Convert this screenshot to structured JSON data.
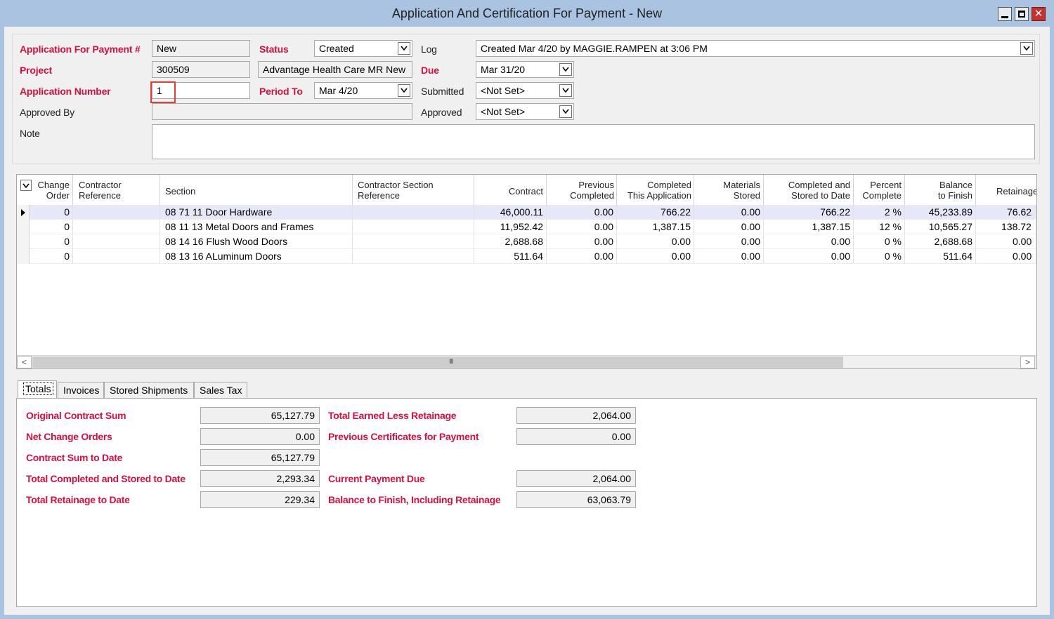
{
  "window": {
    "title": "Application And Certification For Payment - New",
    "close_glyph": "✕"
  },
  "header": {
    "app_payment_label": "Application For Payment #",
    "app_payment_value": "New",
    "project_label": "Project",
    "project_id": "300509",
    "project_name": "Advantage Health Care MR New",
    "app_number_label": "Application Number",
    "app_number_value": "1",
    "approved_by_label": "Approved By",
    "approved_by_value": "",
    "note_label": "Note",
    "note_value": "",
    "status_label": "Status",
    "status_value": "Created",
    "period_to_label": "Period To",
    "period_to_value": "Mar 4/20",
    "log_label": "Log",
    "log_value": "Created Mar 4/20 by MAGGIE.RAMPEN at 3:06 PM",
    "due_label": "Due",
    "due_value": "Mar 31/20",
    "submitted_label": "Submitted",
    "submitted_value": "<Not Set>",
    "approved_label": "Approved",
    "approved_value": "<Not Set>"
  },
  "grid": {
    "columns": [
      "Change\nOrder",
      "Contractor\nReference",
      "Section",
      "Contractor Section\nReference",
      "Contract",
      "Previous\nCompleted",
      "Completed\nThis Application",
      "Materials\nStored",
      "Completed and\nStored to Date",
      "Percent\nComplete",
      "Balance\nto Finish",
      "Retainage"
    ],
    "rows": [
      {
        "change_order": "0",
        "contractor_ref": "",
        "section": "08 71 11 Door Hardware",
        "section_ref": "",
        "contract": "46,000.11",
        "previous": "0.00",
        "this_app": "766.22",
        "materials": "0.00",
        "to_date": "766.22",
        "percent": "2 %",
        "balance": "45,233.89",
        "retainage": "76.62"
      },
      {
        "change_order": "0",
        "contractor_ref": "",
        "section": "08 11 13 Metal Doors and Frames",
        "section_ref": "",
        "contract": "11,952.42",
        "previous": "0.00",
        "this_app": "1,387.15",
        "materials": "0.00",
        "to_date": "1,387.15",
        "percent": "12 %",
        "balance": "10,565.27",
        "retainage": "138.72"
      },
      {
        "change_order": "0",
        "contractor_ref": "",
        "section": "08 14 16 Flush Wood Doors",
        "section_ref": "",
        "contract": "2,688.68",
        "previous": "0.00",
        "this_app": "0.00",
        "materials": "0.00",
        "to_date": "0.00",
        "percent": "0 %",
        "balance": "2,688.68",
        "retainage": "0.00"
      },
      {
        "change_order": "0",
        "contractor_ref": "",
        "section": "08 13 16 ALuminum Doors",
        "section_ref": "",
        "contract": "511.64",
        "previous": "0.00",
        "this_app": "0.00",
        "materials": "0.00",
        "to_date": "0.00",
        "percent": "0 %",
        "balance": "511.64",
        "retainage": "0.00"
      }
    ],
    "scroll_grip": "III",
    "scroll_left": "<",
    "scroll_right": ">"
  },
  "tabs": [
    "Totals",
    "Invoices",
    "Stored Shipments",
    "Sales Tax"
  ],
  "totals": {
    "original_contract_label": "Original Contract Sum",
    "original_contract_value": "65,127.79",
    "net_change_label": "Net Change Orders",
    "net_change_value": "0.00",
    "contract_to_date_label": "Contract Sum to Date",
    "contract_to_date_value": "65,127.79",
    "completed_stored_label": "Total Completed and Stored to Date",
    "completed_stored_value": "2,293.34",
    "retainage_label": "Total Retainage to Date",
    "retainage_value": "229.34",
    "earned_less_label": "Total Earned Less Retainage",
    "earned_less_value": "2,064.00",
    "previous_certs_label": "Previous Certificates for Payment",
    "previous_certs_value": "0.00",
    "current_due_label": "Current Payment Due",
    "current_due_value": "2,064.00",
    "balance_finish_label": "Balance to Finish, Including Retainage",
    "balance_finish_value": "63,063.79"
  },
  "icons": {
    "dropdown": "chevron-down-icon",
    "minimize": "minimize-icon",
    "maximize": "maximize-icon",
    "close": "close-icon",
    "row_pointer": "row-pointer-icon"
  }
}
